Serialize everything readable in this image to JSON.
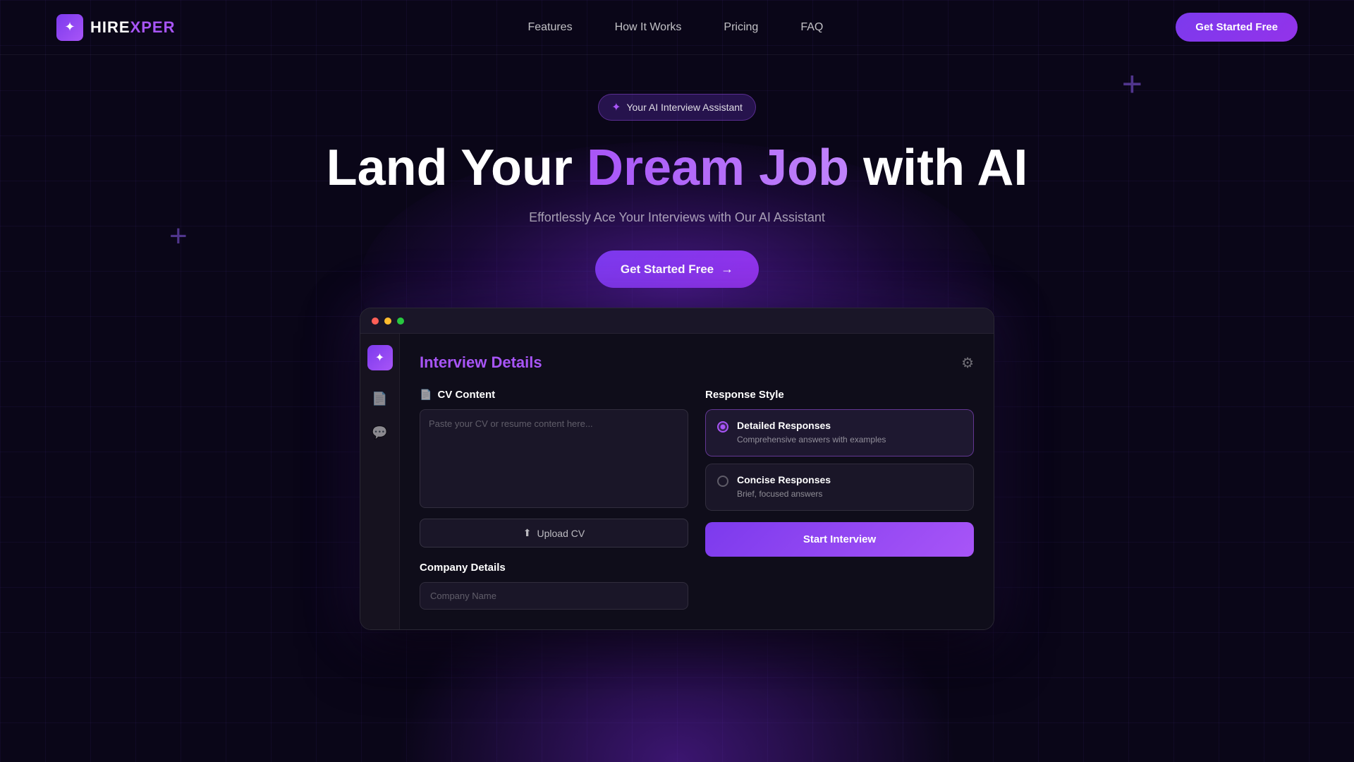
{
  "brand": {
    "name": "HIREXPER",
    "logo_icon": "✦"
  },
  "nav": {
    "links": [
      {
        "id": "features",
        "label": "Features"
      },
      {
        "id": "how-it-works",
        "label": "How It Works"
      },
      {
        "id": "pricing",
        "label": "Pricing"
      },
      {
        "id": "faq",
        "label": "FAQ"
      }
    ],
    "cta_label": "Get Started Free"
  },
  "hero": {
    "badge_icon": "✦",
    "badge_text": "Your AI Interview Assistant",
    "headline_plain": "Land Your ",
    "headline_gradient": "Dream Job",
    "headline_suffix": " with AI",
    "subtext": "Effortlessly Ace Your Interviews with Our AI Assistant",
    "cta_label": "Get Started Free"
  },
  "decorations": {
    "plus1": "+",
    "plus2": "+"
  },
  "app": {
    "window_title": "Interview Details",
    "settings_icon": "⚙",
    "left": {
      "cv_section_icon": "📄",
      "cv_section_label": "CV Content",
      "cv_placeholder": "Paste your CV or resume content here...",
      "upload_label": "Upload CV",
      "company_section_label": "Company Details",
      "company_placeholder": "Company Name"
    },
    "right": {
      "response_style_label": "Response Style",
      "options": [
        {
          "id": "detailed",
          "label": "Detailed Responses",
          "description": "Comprehensive answers with examples",
          "selected": true
        },
        {
          "id": "concise",
          "label": "Concise Responses",
          "description": "Brief, focused answers",
          "selected": false
        }
      ],
      "start_btn_label": "Start Interview"
    },
    "sidebar": {
      "logo_icon": "✦",
      "icons": [
        "📄",
        "💬"
      ]
    }
  }
}
